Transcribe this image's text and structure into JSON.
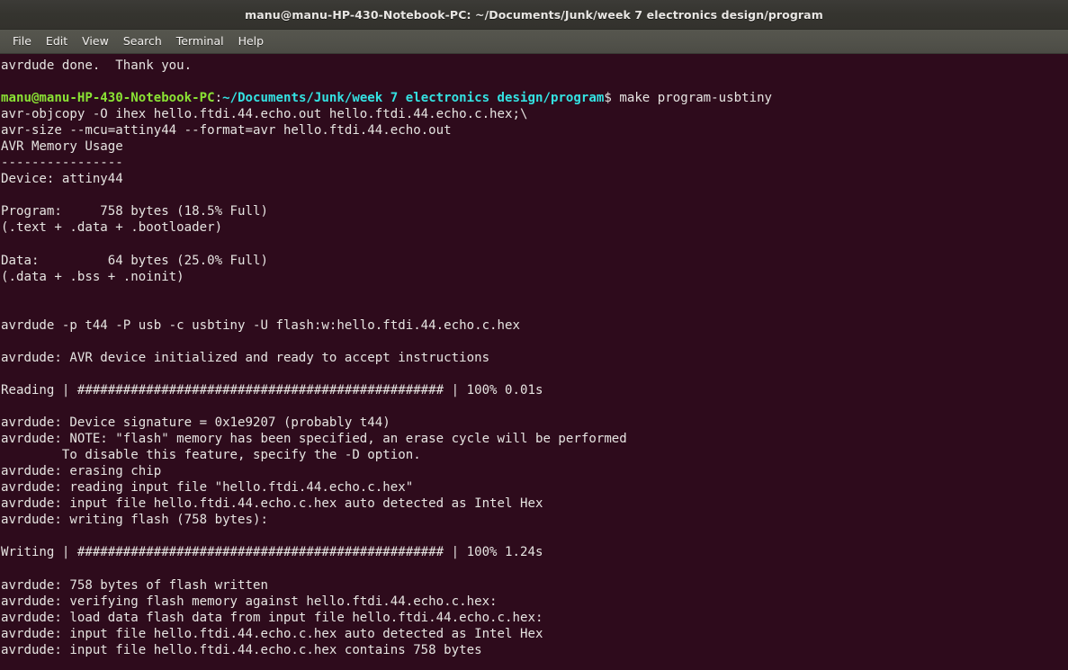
{
  "window": {
    "title": "manu@manu-HP-430-Notebook-PC: ~/Documents/Junk/week 7 electronics design/program"
  },
  "menubar": {
    "items": [
      {
        "label": "File"
      },
      {
        "label": "Edit"
      },
      {
        "label": "View"
      },
      {
        "label": "Search"
      },
      {
        "label": "Terminal"
      },
      {
        "label": "Help"
      }
    ]
  },
  "colors": {
    "terminal_background": "#2e0b1c",
    "terminal_foreground": "#e6e4e1",
    "prompt_user_host": "#8ae234",
    "prompt_path": "#34e2e2",
    "titlebar_background": "#35342f",
    "menubar_background": "#51514a"
  },
  "prompt": {
    "user_host": "manu@manu-HP-430-Notebook-PC",
    "separator": ":",
    "path": "~/Documents/Junk/week 7 electronics design/program",
    "symbol": "$",
    "command": " make program-usbtiny"
  },
  "terminal": {
    "lines": [
      "avrdude done.  Thank you.",
      "",
      "__PROMPT__",
      "avr-objcopy -O ihex hello.ftdi.44.echo.out hello.ftdi.44.echo.c.hex;\\",
      "avr-size --mcu=attiny44 --format=avr hello.ftdi.44.echo.out",
      "AVR Memory Usage",
      "----------------",
      "Device: attiny44",
      "",
      "Program:     758 bytes (18.5% Full)",
      "(.text + .data + .bootloader)",
      "",
      "Data:         64 bytes (25.0% Full)",
      "(.data + .bss + .noinit)",
      "",
      "",
      "avrdude -p t44 -P usb -c usbtiny -U flash:w:hello.ftdi.44.echo.c.hex",
      "",
      "avrdude: AVR device initialized and ready to accept instructions",
      "",
      "Reading | ################################################ | 100% 0.01s",
      "",
      "avrdude: Device signature = 0x1e9207 (probably t44)",
      "avrdude: NOTE: \"flash\" memory has been specified, an erase cycle will be performed",
      "        To disable this feature, specify the -D option.",
      "avrdude: erasing chip",
      "avrdude: reading input file \"hello.ftdi.44.echo.c.hex\"",
      "avrdude: input file hello.ftdi.44.echo.c.hex auto detected as Intel Hex",
      "avrdude: writing flash (758 bytes):",
      "",
      "Writing | ################################################ | 100% 1.24s",
      "",
      "avrdude: 758 bytes of flash written",
      "avrdude: verifying flash memory against hello.ftdi.44.echo.c.hex:",
      "avrdude: load data flash data from input file hello.ftdi.44.echo.c.hex:",
      "avrdude: input file hello.ftdi.44.echo.c.hex auto detected as Intel Hex",
      "avrdude: input file hello.ftdi.44.echo.c.hex contains 758 bytes"
    ]
  }
}
